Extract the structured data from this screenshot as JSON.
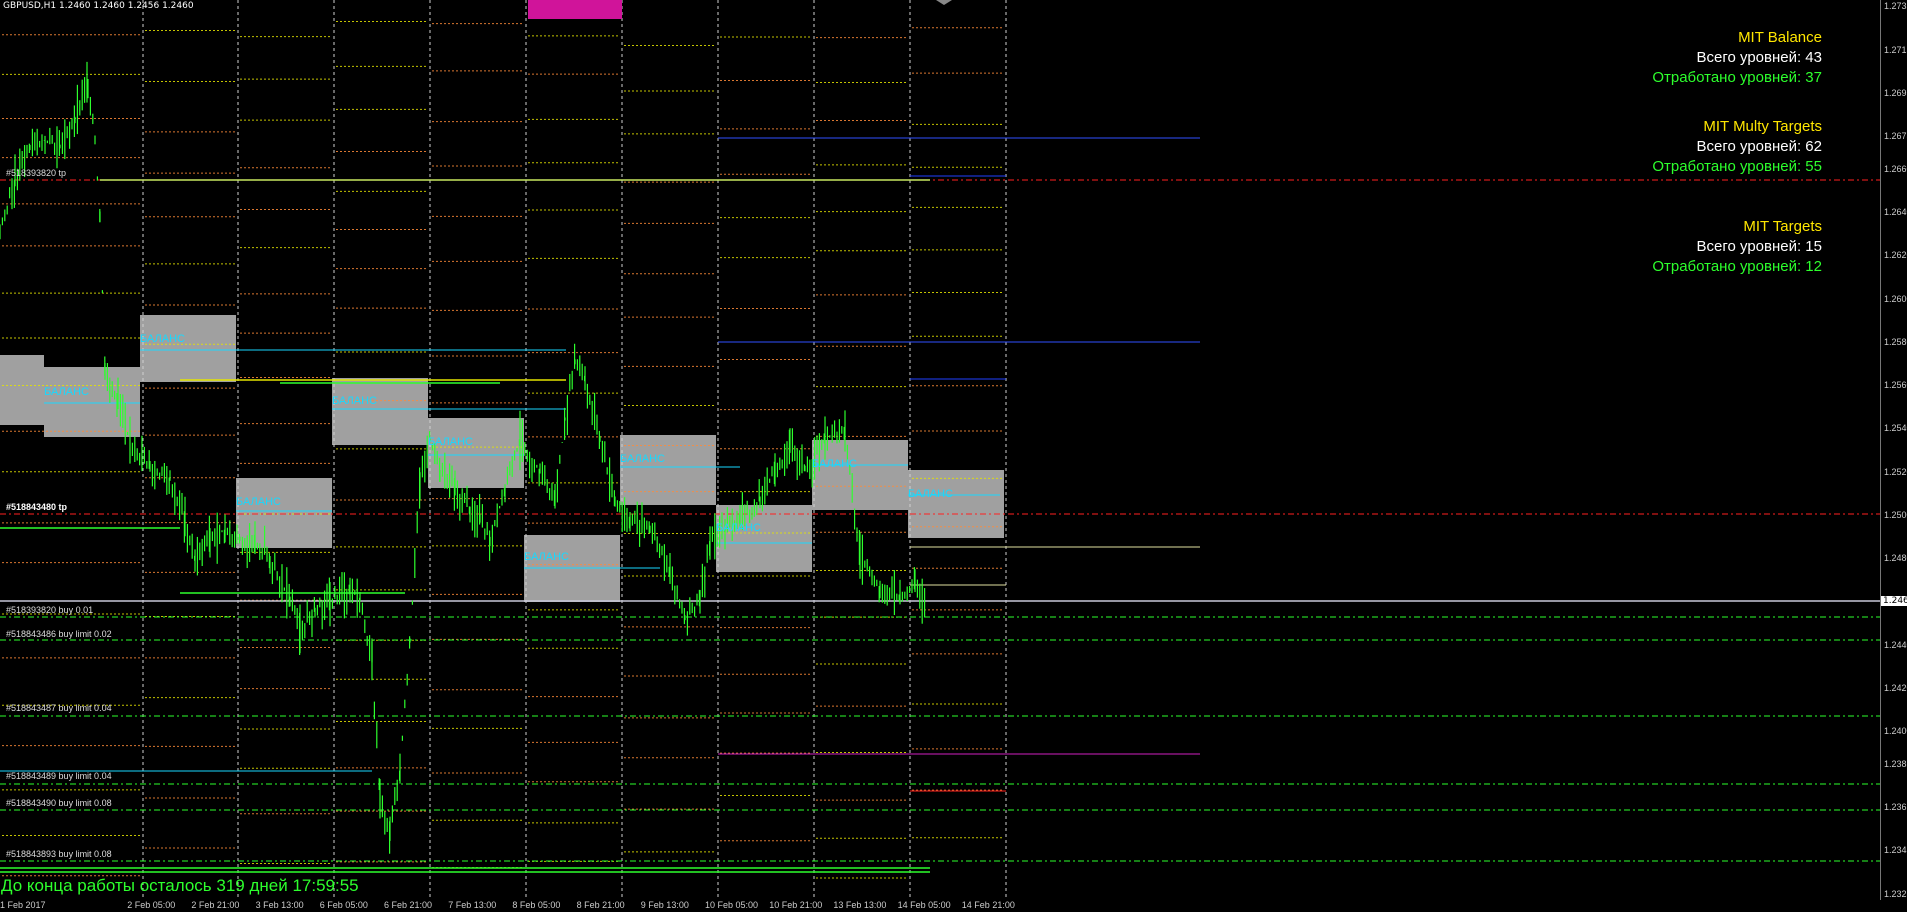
{
  "symbol_info": "GBPUSD,H1  1.2460 1.2460 1.2456 1.2460",
  "panels": [
    {
      "title": "MIT Balance",
      "total": "Всего уровней: 43",
      "done": "Отработано уровней: 37"
    },
    {
      "title": "MIT Multy Targets",
      "total": "Всего уровней: 62",
      "done": "Отработано уровней: 55"
    },
    {
      "title": "MIT Targets",
      "total": "Всего уровней: 15",
      "done": "Отработано уровней: 12"
    }
  ],
  "countdown": "До конца работы осталось 319 дней 17:59:55",
  "balance_label": "БАЛАНС",
  "order_labels": [
    "#518393820 tp",
    "#518843480 tp",
    "#518393820 buy 0.01",
    "#518843486 buy limit 0.02",
    "#518843487 buy limit 0.04",
    "#518843489 buy limit 0.04",
    "#518843490 buy limit 0.08",
    "#518843893 buy limit 0.08"
  ],
  "price_axis": {
    "labels": [
      "1.2735",
      "1.2715",
      "1.2695",
      "1.2675",
      "1.2660",
      "1.2640",
      "1.2620",
      "1.2600",
      "1.2580",
      "1.2560",
      "1.2540",
      "1.2520",
      "1.2500",
      "1.2480",
      "1.2460",
      "1.2440",
      "1.2420",
      "1.2400",
      "1.2385",
      "1.2365",
      "1.2345",
      "1.2325"
    ],
    "current": "1.2460",
    "min": 1.2322,
    "max": 1.2738
  },
  "time_axis": [
    "1 Feb 2017",
    "2 Feb 05:00",
    "2 Feb 21:00",
    "3 Feb 13:00",
    "6 Feb 05:00",
    "6 Feb 21:00",
    "7 Feb 13:00",
    "8 Feb 05:00",
    "8 Feb 21:00",
    "9 Feb 13:00",
    "10 Feb 05:00",
    "10 Feb 21:00",
    "13 Feb 13:00",
    "14 Feb 05:00",
    "14 Feb 21:00"
  ],
  "colors": {
    "background": "#000000",
    "candle": "#2dff2d",
    "balance_box": "#a0a0a0",
    "balance_text": "#17d9ff",
    "grid": "#cfcfcf",
    "tp_line": "#ff2020",
    "buy_line": "#2dff2d",
    "target_orange": "#ff8c3a",
    "target_yellow": "#e5e500",
    "blue_level": "#2040ff",
    "magenta_level": "#d020c0",
    "marker": "#d0149a"
  }
}
